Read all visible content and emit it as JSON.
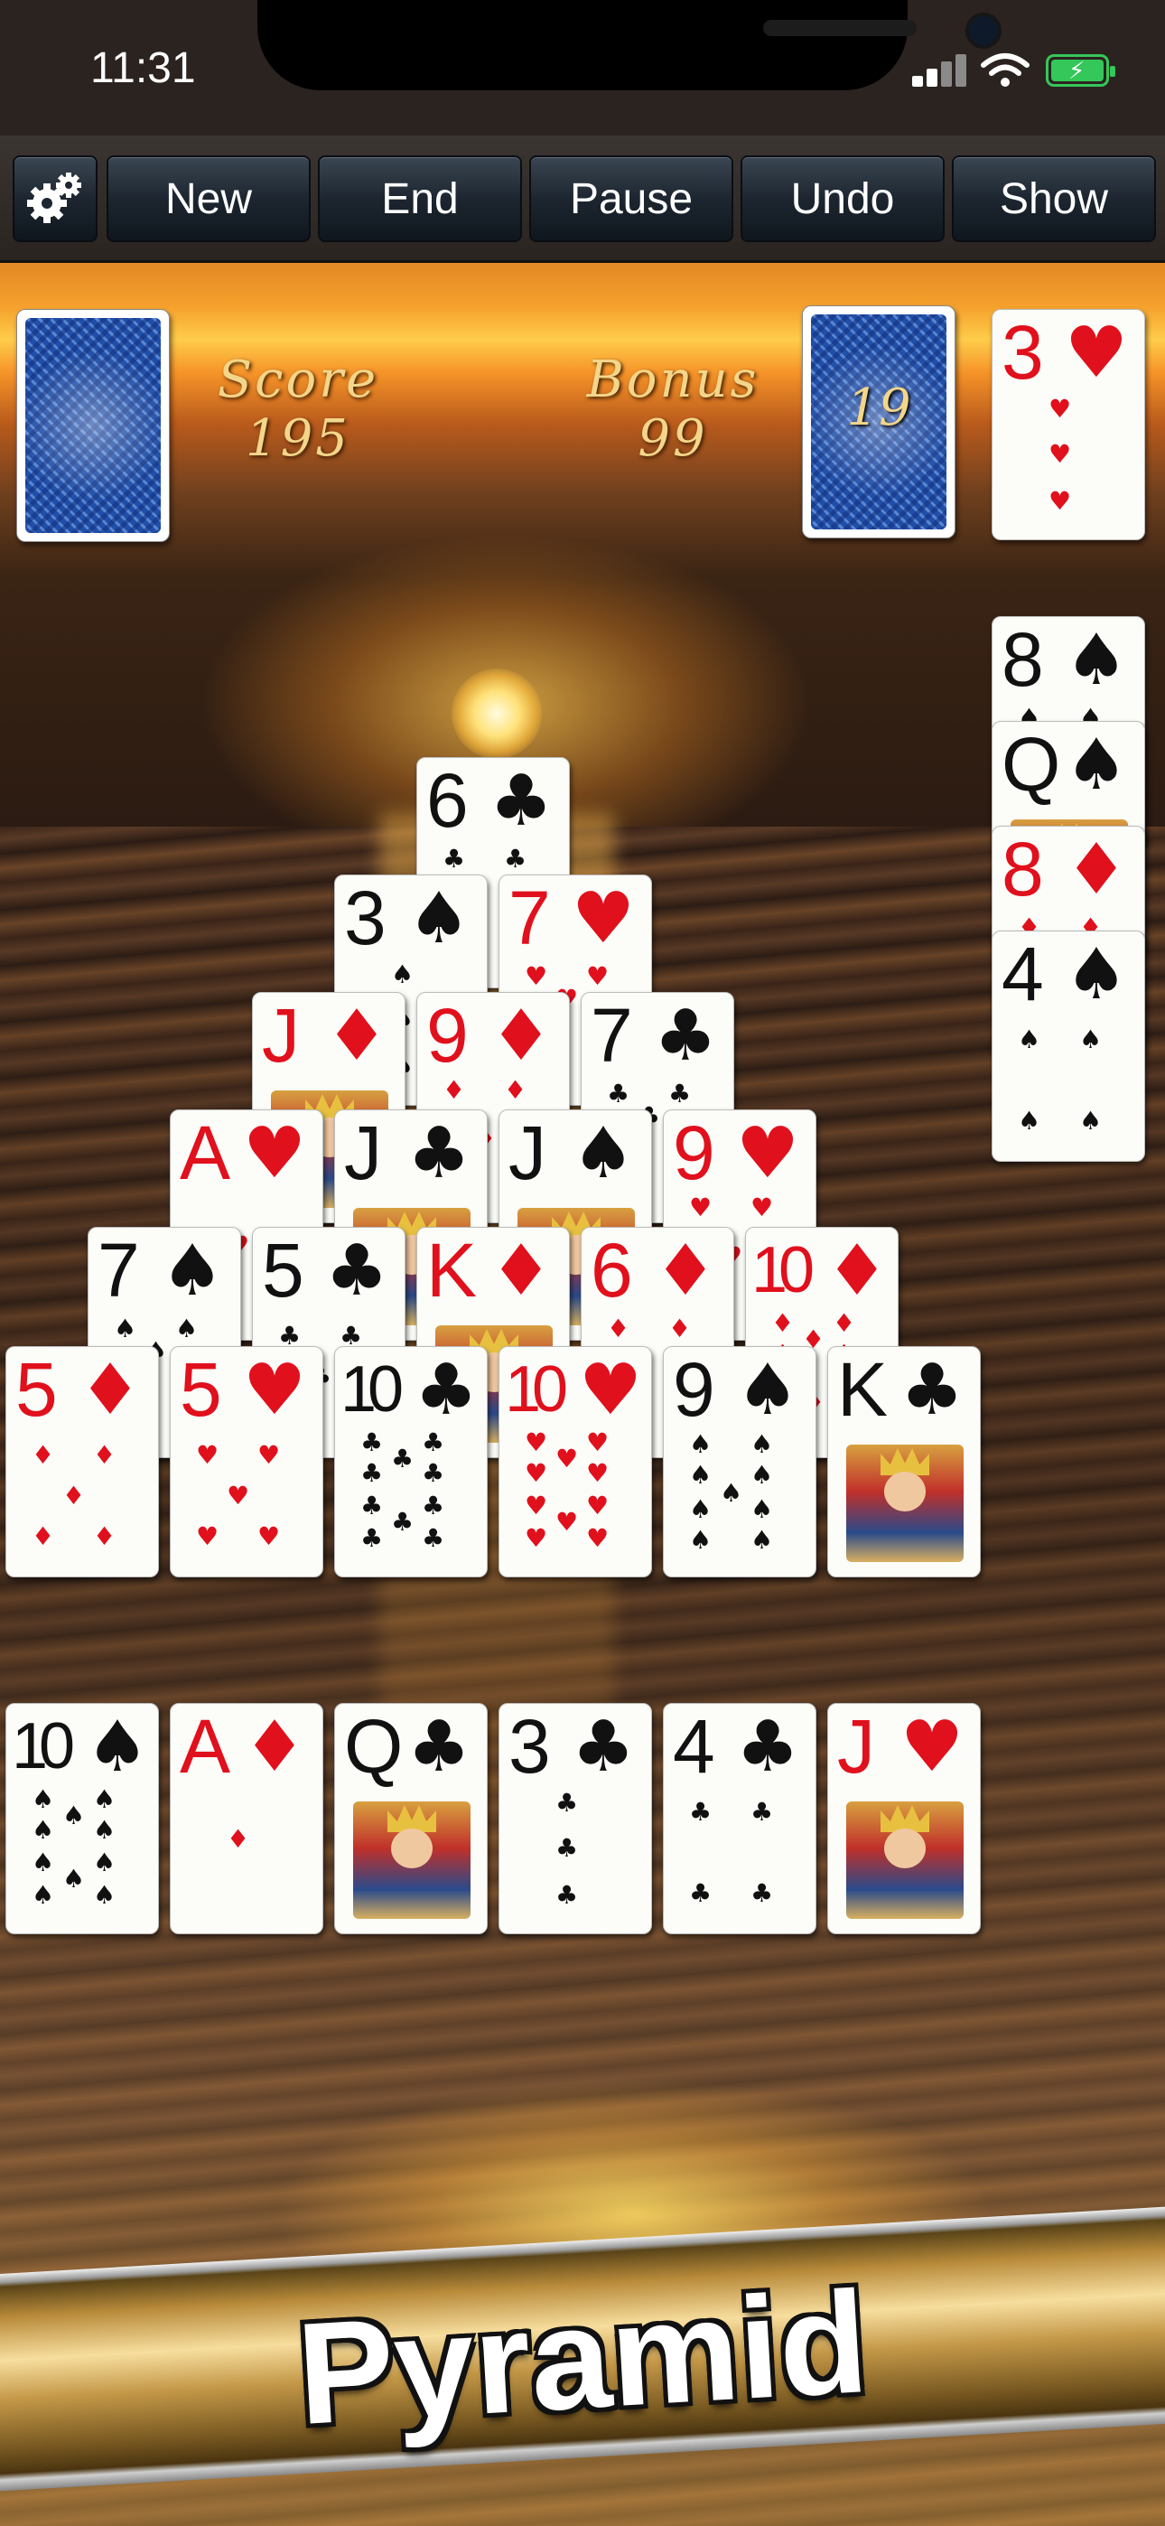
{
  "status": {
    "time": "11:31"
  },
  "toolbar": {
    "settings_icon": "gear-icon",
    "buttons": [
      "New",
      "End",
      "Pause",
      "Undo",
      "Show"
    ]
  },
  "score": {
    "label": "Score",
    "value": "195"
  },
  "bonus": {
    "label": "Bonus",
    "value": "99"
  },
  "stock": {
    "count": "19"
  },
  "waste_card": {
    "rank": "3",
    "suit": "♥"
  },
  "discard_pile": [
    {
      "rank": "8",
      "suit": "♠"
    },
    {
      "rank": "Q",
      "suit": "♠"
    },
    {
      "rank": "8",
      "suit": "♦"
    },
    {
      "rank": "4",
      "suit": "♠"
    }
  ],
  "pyramid": [
    [
      {
        "rank": "6",
        "suit": "♣"
      }
    ],
    [
      {
        "rank": "3",
        "suit": "♠"
      },
      {
        "rank": "7",
        "suit": "♥"
      }
    ],
    [
      {
        "rank": "J",
        "suit": "♦"
      },
      {
        "rank": "9",
        "suit": "♦"
      },
      {
        "rank": "7",
        "suit": "♣"
      }
    ],
    [
      {
        "rank": "A",
        "suit": "♥"
      },
      {
        "rank": "J",
        "suit": "♣"
      },
      {
        "rank": "J",
        "suit": "♠"
      },
      {
        "rank": "9",
        "suit": "♥"
      }
    ],
    [
      {
        "rank": "7",
        "suit": "♠"
      },
      {
        "rank": "5",
        "suit": "♣"
      },
      {
        "rank": "K",
        "suit": "♦"
      },
      {
        "rank": "6",
        "suit": "♦"
      },
      {
        "rank": "10",
        "suit": "♦"
      }
    ],
    [
      {
        "rank": "5",
        "suit": "♦"
      },
      {
        "rank": "5",
        "suit": "♥"
      },
      {
        "rank": "10",
        "suit": "♣"
      },
      {
        "rank": "10",
        "suit": "♥"
      },
      {
        "rank": "9",
        "suit": "♠"
      },
      {
        "rank": "K",
        "suit": "♣"
      }
    ]
  ],
  "bottom_row": [
    {
      "rank": "10",
      "suit": "♠"
    },
    {
      "rank": "A",
      "suit": "♦"
    },
    {
      "rank": "Q",
      "suit": "♣"
    },
    {
      "rank": "3",
      "suit": "♣"
    },
    {
      "rank": "4",
      "suit": "♣"
    },
    {
      "rank": "J",
      "suit": "♥"
    }
  ],
  "banner": {
    "title": "Pyramid"
  }
}
